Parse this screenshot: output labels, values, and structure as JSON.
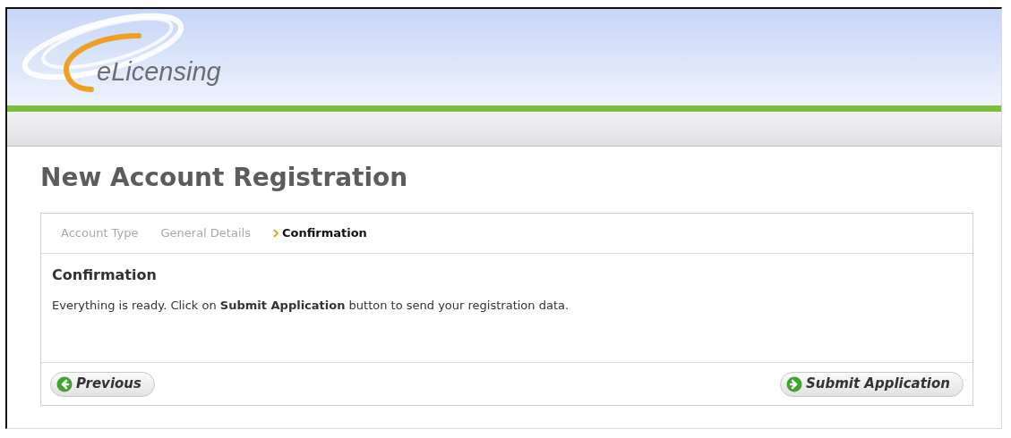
{
  "header": {
    "logo_text": "eLicensing"
  },
  "page_title": "New Account Registration",
  "steps": [
    {
      "label": "Account Type",
      "selected": false
    },
    {
      "label": "General Details",
      "selected": false
    },
    {
      "label": "Confirmation",
      "selected": true
    }
  ],
  "section": {
    "title": "Confirmation",
    "message": "Everything is ready. Click on **Submit Application** button to send your registration data."
  },
  "buttons": [
    {
      "label": "Previous",
      "kind": "back"
    },
    {
      "label": "Submit Application",
      "kind": "forward"
    }
  ]
}
